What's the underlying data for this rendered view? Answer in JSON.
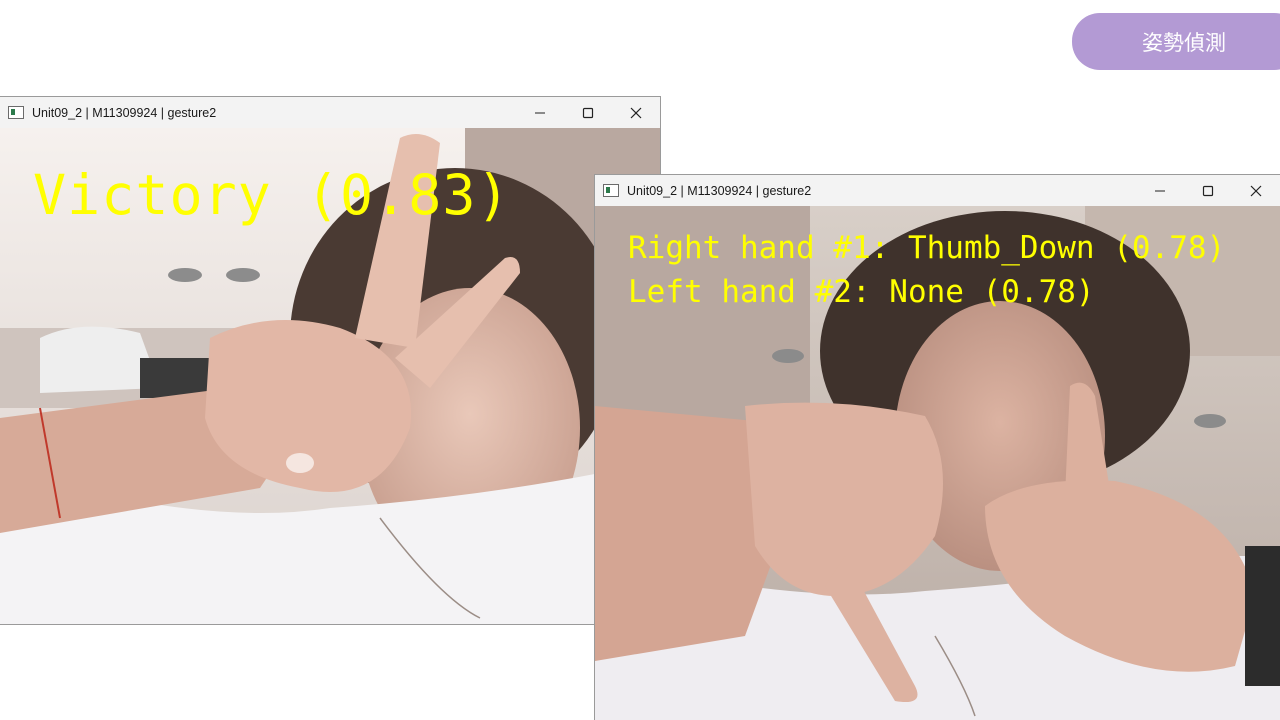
{
  "slide": {
    "badge_text": "姿勢偵測"
  },
  "windows": [
    {
      "title": "Unit09_2 | M11309924 | gesture2",
      "controls": {
        "minimize": "—",
        "maximize": "☐",
        "close": "✕"
      },
      "overlay_lines": [
        "Victory (0.83)"
      ]
    },
    {
      "title": "Unit09_2 | M11309924 | gesture2",
      "controls": {
        "minimize": "—",
        "maximize": "☐",
        "close": "✕"
      },
      "overlay_lines": [
        "Right hand #1: Thumb_Down (0.78)",
        "Left hand #2: None (0.78)"
      ]
    }
  ],
  "colors": {
    "overlay_text": "#ffff00",
    "badge_bg": "#b39ad4",
    "titlebar_bg": "#f3f3f3"
  }
}
